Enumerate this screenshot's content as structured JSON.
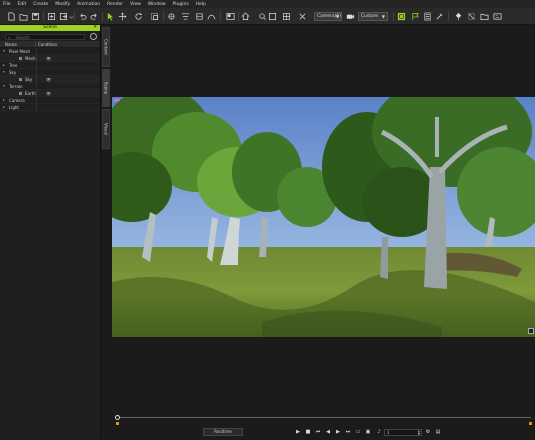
{
  "menu": [
    "File",
    "Edit",
    "Create",
    "Modify",
    "Animation",
    "Render",
    "View",
    "Window",
    "Plugins",
    "Help"
  ],
  "toolbar": {
    "camera_select": "Camera(0)",
    "render_select": "Custom",
    "accent": "#9cd320"
  },
  "panel": {
    "title": "Scene",
    "search_placeholder": "Search",
    "col_name": "Name",
    "col_condition": "Condition",
    "tree": {
      "pixel_mesh": "Pixel Mesh",
      "mesh": "Mesh",
      "tree": "Tree",
      "sky": "Sky",
      "sky_child": "Sky",
      "terrain": "Terrain",
      "terrain_child": "Earth",
      "camera": "Camera",
      "light": "Light"
    },
    "side_tabs": [
      "Content",
      "Scene",
      "Visual"
    ]
  },
  "timeline": {
    "mode": "Realtime",
    "frame": "1"
  }
}
